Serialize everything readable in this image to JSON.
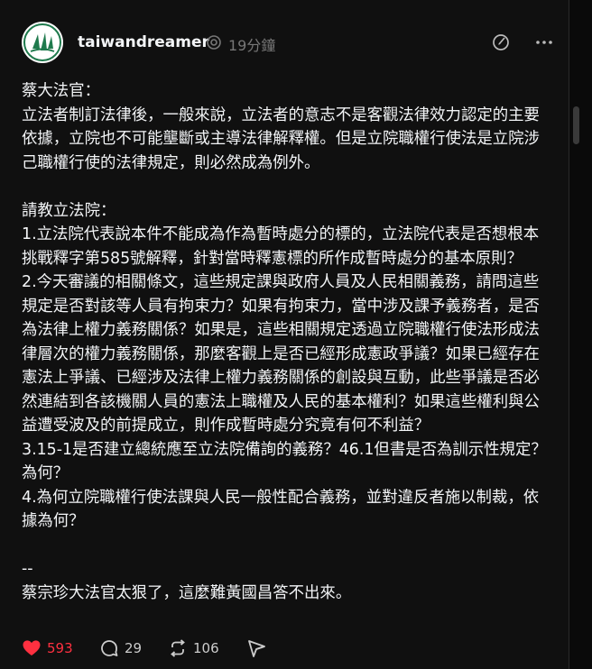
{
  "post": {
    "author": "taiwandreamer",
    "time_ago": "19分鐘",
    "body": "蔡大法官：\n立法者制訂法律後，一般來說，立法者的意志不是客觀法律效力認定的主要依據，立院也不可能壟斷或主導法律解釋權。但是立院職權行使法是立院涉己職權行使的法律規定，則必然成為例外。\n\n請教立法院：\n1.立法院代表說本件不能成為作為暫時處分的標的，立法院代表是否想根本挑戰釋字第585號解釋，針對當時釋憲標的所作成暫時處分的基本原則？\n2.今天審議的相關條文，這些規定課與政府人員及人民相關義務，請問這些規定是否對該等人員有拘束力？如果有拘束力，當中涉及課予義務者，是否為法律上權力義務關係？如果是，這些相關規定透過立院職權行使法形成法律層次的權力義務關係，那麼客觀上是否已經形成憲政爭議？如果已經存在憲法上爭議、已經涉及法律上權力義務關係的創設與互動，此些爭議是否必然連結到各該機關人員的憲法上職權及人民的基本權利？如果這些權利與公益遭受波及的前提成立，則作成暫時處分究竟有何不利益？\n3.15-1是否建立總統應至立法院備詢的義務？46.1但書是否為訓示性規定？為何？\n4.為何立院職權行使法課與人民一般性配合義務，並對違反者施以制裁，依據為何？\n\n--\n蔡宗珍大法官太狠了，這麼難黃國昌答不出來。",
    "likes": "593",
    "replies": "29",
    "reposts": "106"
  },
  "colors": {
    "like": "#ff3040",
    "text": "#f3f5f7",
    "muted": "#777777",
    "avatar_green": "#1f7a4d"
  },
  "icons": {
    "verified": "verified-badge-icon",
    "edit": "edit-icon",
    "more": "more-icon",
    "like": "heart-icon",
    "reply": "comment-icon",
    "repost": "repost-icon",
    "share": "send-icon"
  }
}
